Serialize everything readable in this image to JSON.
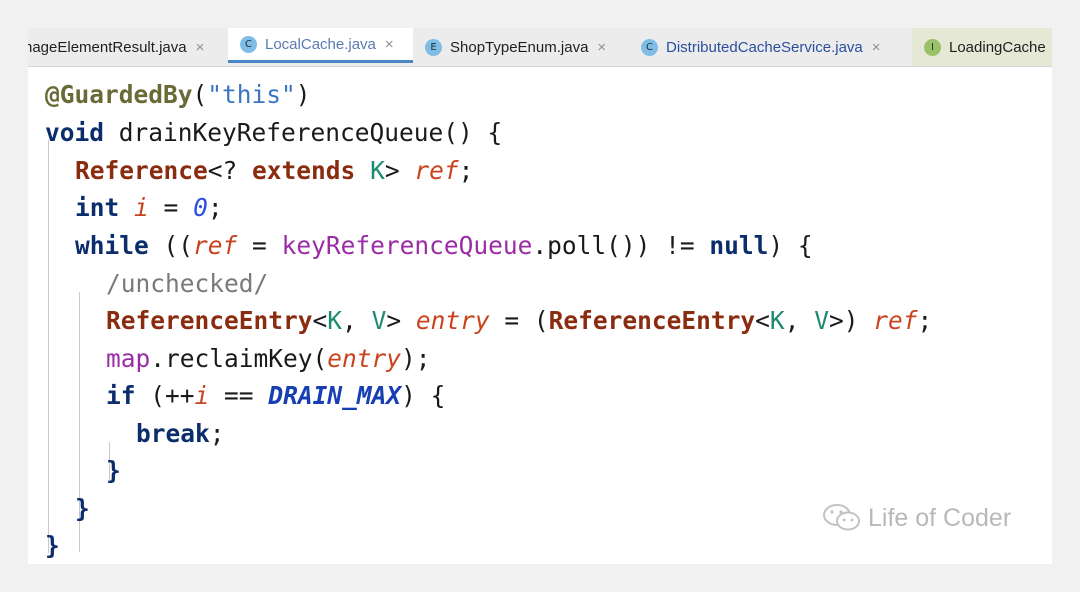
{
  "tabs": [
    {
      "label": "nageElementResult.java",
      "icon": "",
      "active": false
    },
    {
      "label": "LocalCache.java",
      "icon": "C",
      "active": true
    },
    {
      "label": "ShopTypeEnum.java",
      "icon": "E",
      "active": false
    },
    {
      "label": "DistributedCacheService.java",
      "icon": "C",
      "active": false
    },
    {
      "label": "LoadingCache",
      "icon": "I",
      "active": false
    }
  ],
  "close_glyph": "×",
  "code": {
    "l1": {
      "anno": "@GuardedBy",
      "p1": "(",
      "str": "\"this\"",
      "p2": ")"
    },
    "l2": {
      "kw": "void",
      "rest": " drainKeyReferenceQueue() {"
    },
    "l3": {
      "ty": "Reference",
      "a": "<? ",
      "kw": "extends",
      "b": " ",
      "tp": "K",
      "c": "> ",
      "var": "ref",
      "d": ";"
    },
    "l4": {
      "kw": "int",
      "a": " ",
      "var": "i",
      "b": " = ",
      "num": "0",
      "c": ";"
    },
    "l5": {
      "kw": "while",
      "a": " ((",
      "var": "ref",
      "b": " = ",
      "fld": "keyReferenceQueue",
      "c": ".poll()) != ",
      "kw2": "null",
      "d": ") {"
    },
    "l6": {
      "cmt": "/unchecked/"
    },
    "l7": {
      "ty": "ReferenceEntry",
      "a": "<",
      "tp1": "K",
      "b": ", ",
      "tp2": "V",
      "c": "> ",
      "var": "entry",
      "d": " = (",
      "ty2": "ReferenceEntry",
      "e": "<",
      "tp3": "K",
      "f": ", ",
      "tp4": "V",
      "g": ">) ",
      "var2": "ref",
      "h": ";"
    },
    "l8": {
      "fld": "map",
      "a": ".reclaimKey(",
      "var": "entry",
      "b": ");"
    },
    "l9": {
      "kw": "if",
      "a": " (++",
      "var": "i",
      "b": " == ",
      "cst": "DRAIN_MAX",
      "c": ") {"
    },
    "l10": {
      "kw": "break",
      "a": ";"
    },
    "l11": {
      "a": "}"
    },
    "l12": {
      "a": "}"
    },
    "l13": {
      "a": "}"
    }
  },
  "watermark": "Life of Coder",
  "colors": {
    "keyword": "#0b2d6b",
    "type": "#8a2c10",
    "string": "#3a75c4",
    "variable": "#c9441e",
    "field": "#9a2ca6",
    "constant": "#173fb3",
    "active_tab_underline": "#4a86c8"
  }
}
